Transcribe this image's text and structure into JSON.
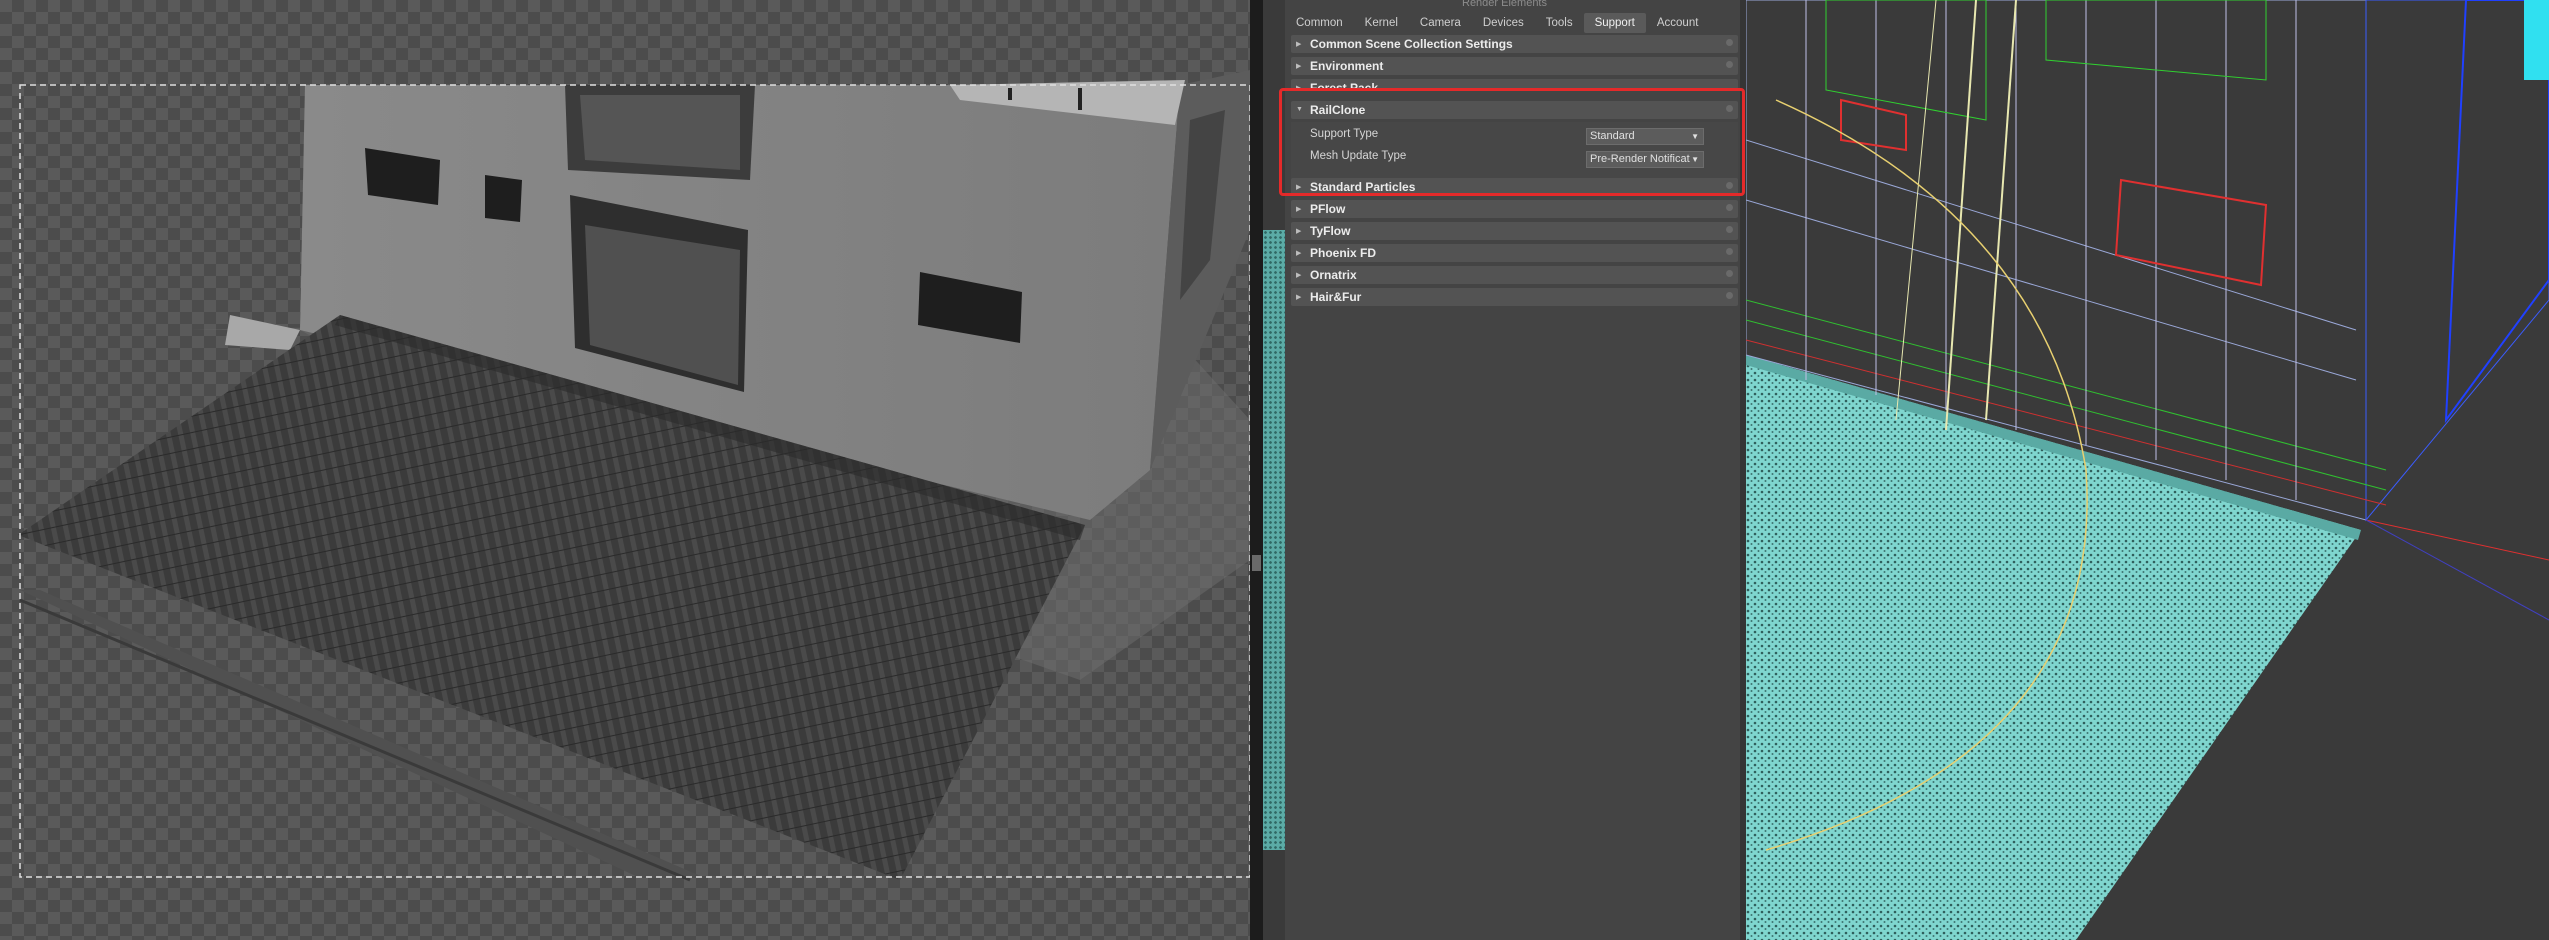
{
  "panel": {
    "window_title": "Render Elements",
    "tabs": [
      {
        "label": "Common",
        "active": false
      },
      {
        "label": "Kernel",
        "active": false
      },
      {
        "label": "Camera",
        "active": false
      },
      {
        "label": "Devices",
        "active": false
      },
      {
        "label": "Tools",
        "active": false
      },
      {
        "label": "Support",
        "active": true
      },
      {
        "label": "Account",
        "active": false
      }
    ],
    "rollouts": {
      "common_scene": "Common Scene Collection Settings",
      "environment": "Environment",
      "forest_pack": "Forest Pack",
      "railclone": "RailClone",
      "standard_particles": "Standard Particles",
      "pflow": "PFlow",
      "tyflow": "TyFlow",
      "phoenix_fd": "Phoenix FD",
      "ornatrix": "Ornatrix",
      "hair_fur": "Hair&Fur"
    },
    "railclone": {
      "support_type_label": "Support Type",
      "support_type_value": "Standard",
      "mesh_update_label": "Mesh Update Type",
      "mesh_update_value": "Pre-Render Notificati"
    }
  },
  "colors": {
    "highlight": "#e52a2a",
    "panel_bg": "#444444",
    "rollout_bg": "#535353",
    "viewport_bg": "#3a3a3a",
    "scatter_cyan": "#7fd6cf"
  },
  "icons": {
    "collapsed_rollout": "triangle-right-icon",
    "expanded_rollout": "triangle-down-icon",
    "dropdown": "chevron-down-icon"
  }
}
